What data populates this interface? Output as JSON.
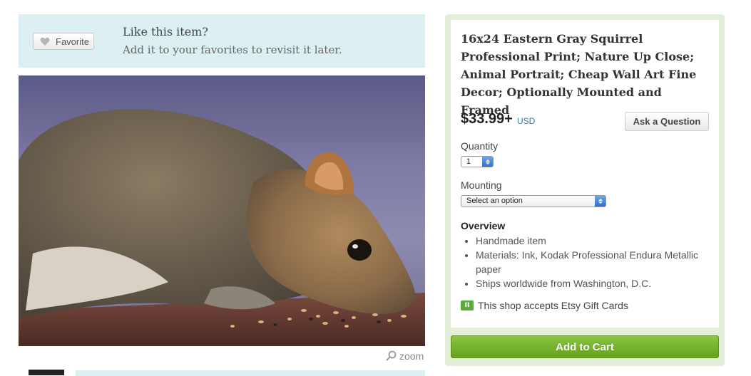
{
  "favorite_banner": {
    "button_label": "Favorite",
    "title": "Like this item?",
    "subtitle": "Add it to your favorites to revisit it later."
  },
  "image": {
    "zoom_label": "zoom",
    "subject": "squirrel"
  },
  "listing": {
    "title": "16x24 Eastern Gray Squirrel Professional Print; Nature Up Close; Animal Portrait; Cheap Wall Art Fine Decor; Optionally Mounted and Framed",
    "price": "$33.99+",
    "currency": "USD",
    "ask_question_label": "Ask a Question",
    "quantity_label": "Quantity",
    "quantity_value": "1",
    "mounting_label": "Mounting",
    "mounting_value": "Select an option",
    "overview_heading": "Overview",
    "overview_items": [
      "Handmade item",
      "Materials: Ink, Kodak Professional Endura Metallic paper",
      "Ships worldwide from Washington, D.C."
    ],
    "gift_cards_text": "This shop accepts Etsy Gift Cards",
    "add_to_cart_label": "Add to Cart"
  },
  "colors": {
    "banner_bg": "#dcf0f2",
    "panel_bg": "#e4efd9",
    "cart_green": "#75b12a",
    "currency_blue": "#2a7fb3",
    "gift_icon_green": "#5aaa3a"
  },
  "icons": [
    "heart-icon",
    "magnifier-icon",
    "gift-card-icon",
    "select-arrows-icon"
  ]
}
